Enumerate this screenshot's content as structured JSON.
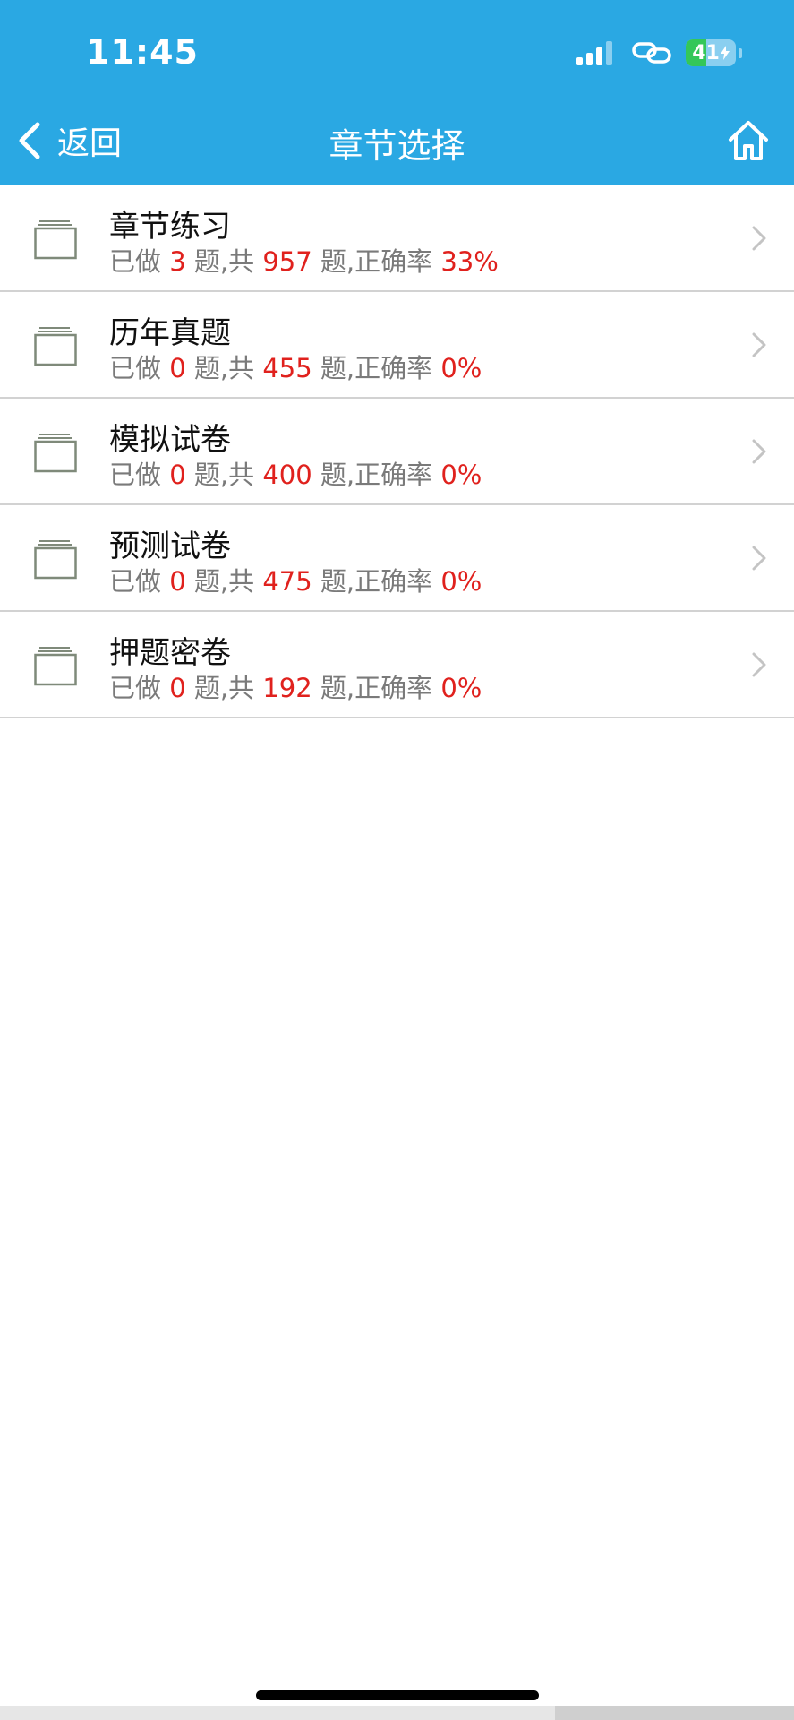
{
  "status_bar": {
    "time": "11:45",
    "battery_level": "41",
    "battery_fraction": 0.41
  },
  "nav": {
    "back_label": "返回",
    "title": "章节选择",
    "icons": {
      "back": "chevron-left-icon",
      "home": "home-icon"
    }
  },
  "colors": {
    "header": "#2aa8e3",
    "highlight_number": "#e0211d",
    "secondary_text": "#7a7a7a"
  },
  "list": [
    {
      "title": "章节练习",
      "done_prefix": "已做 ",
      "done": "3",
      "total_prefix": " 题,共 ",
      "total": "957",
      "rate_prefix": " 题,正确率 ",
      "rate": "33%"
    },
    {
      "title": "历年真题",
      "done_prefix": "已做 ",
      "done": "0",
      "total_prefix": " 题,共 ",
      "total": "455",
      "rate_prefix": " 题,正确率 ",
      "rate": "0%"
    },
    {
      "title": "模拟试卷",
      "done_prefix": "已做 ",
      "done": "0",
      "total_prefix": " 题,共 ",
      "total": "400",
      "rate_prefix": " 题,正确率 ",
      "rate": "0%"
    },
    {
      "title": "预测试卷",
      "done_prefix": "已做 ",
      "done": "0",
      "total_prefix": " 题,共 ",
      "total": "475",
      "rate_prefix": " 题,正确率 ",
      "rate": "0%"
    },
    {
      "title": "押题密卷",
      "done_prefix": "已做 ",
      "done": "0",
      "total_prefix": " 题,共 ",
      "total": "192",
      "rate_prefix": " 题,正确率 ",
      "rate": "0%"
    }
  ]
}
